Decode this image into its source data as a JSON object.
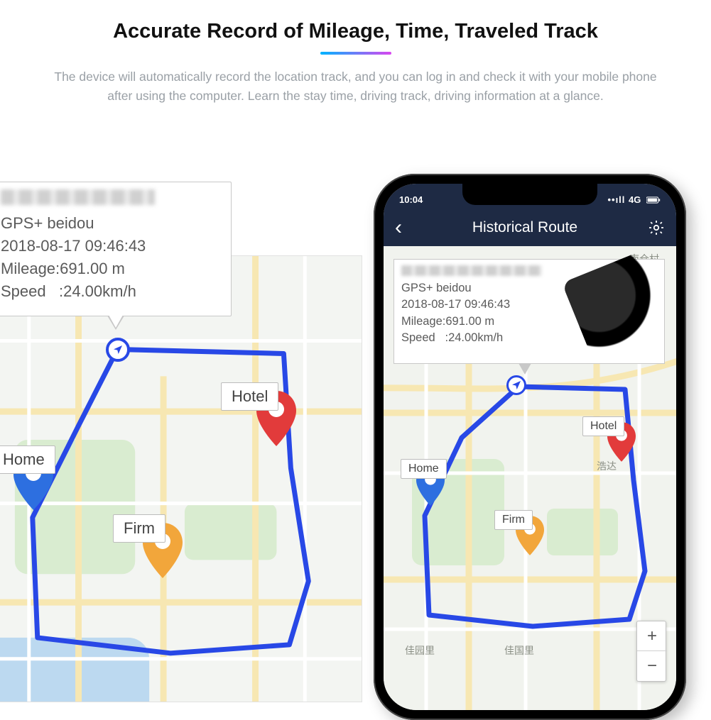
{
  "header": {
    "title": "Accurate Record of Mileage, Time, Traveled Track",
    "description": "The device will automatically record the location track, and you can log in and check it with your mobile phone after using the computer. Learn the stay time, driving track, driving information at a glance."
  },
  "callout": {
    "mode": "GPS+ beidou",
    "timestamp": "2018-08-17 09:46:43",
    "mileage_label": "Mileage:",
    "mileage_value": "691.00 m",
    "speed_label": "Speed",
    "speed_value": ":24.00km/h"
  },
  "pins": {
    "home": "Home",
    "hotel": "Hotel",
    "firm": "Firm"
  },
  "phone": {
    "status_time": "10:04",
    "status_net": "4G",
    "app_title": "Historical Route",
    "zoom_in": "+",
    "zoom_out": "−"
  },
  "map_labels": {
    "a": "南仓村",
    "b": "浩达",
    "c": "浩达",
    "d": "佳园里",
    "e": "佳国里"
  }
}
